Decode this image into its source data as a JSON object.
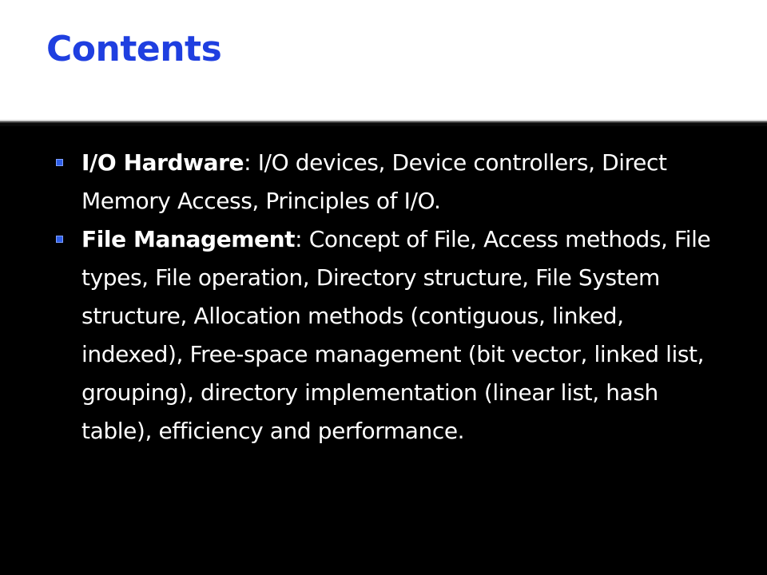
{
  "slide": {
    "title": "Contents",
    "items": [
      {
        "term": "I/O Hardware",
        "separator": ": ",
        "text": "I/O devices, Device controllers, Direct Memory Access, Principles of I/O."
      },
      {
        "term": "File Management",
        "separator": ": ",
        "text": "Concept of File, Access methods, File types, File operation, Directory structure, File System structure, Allocation methods (contiguous, linked, indexed), Free-space management (bit vector, linked list, grouping), directory implementation (linear list, hash table), efficiency and performance."
      }
    ]
  },
  "colors": {
    "title": "#1f3fe0",
    "background": "#000000",
    "header_background": "#ffffff",
    "bullet": "#2f5fe8",
    "text": "#ffffff"
  },
  "icons": {
    "bullet": "square-bullet-icon"
  }
}
